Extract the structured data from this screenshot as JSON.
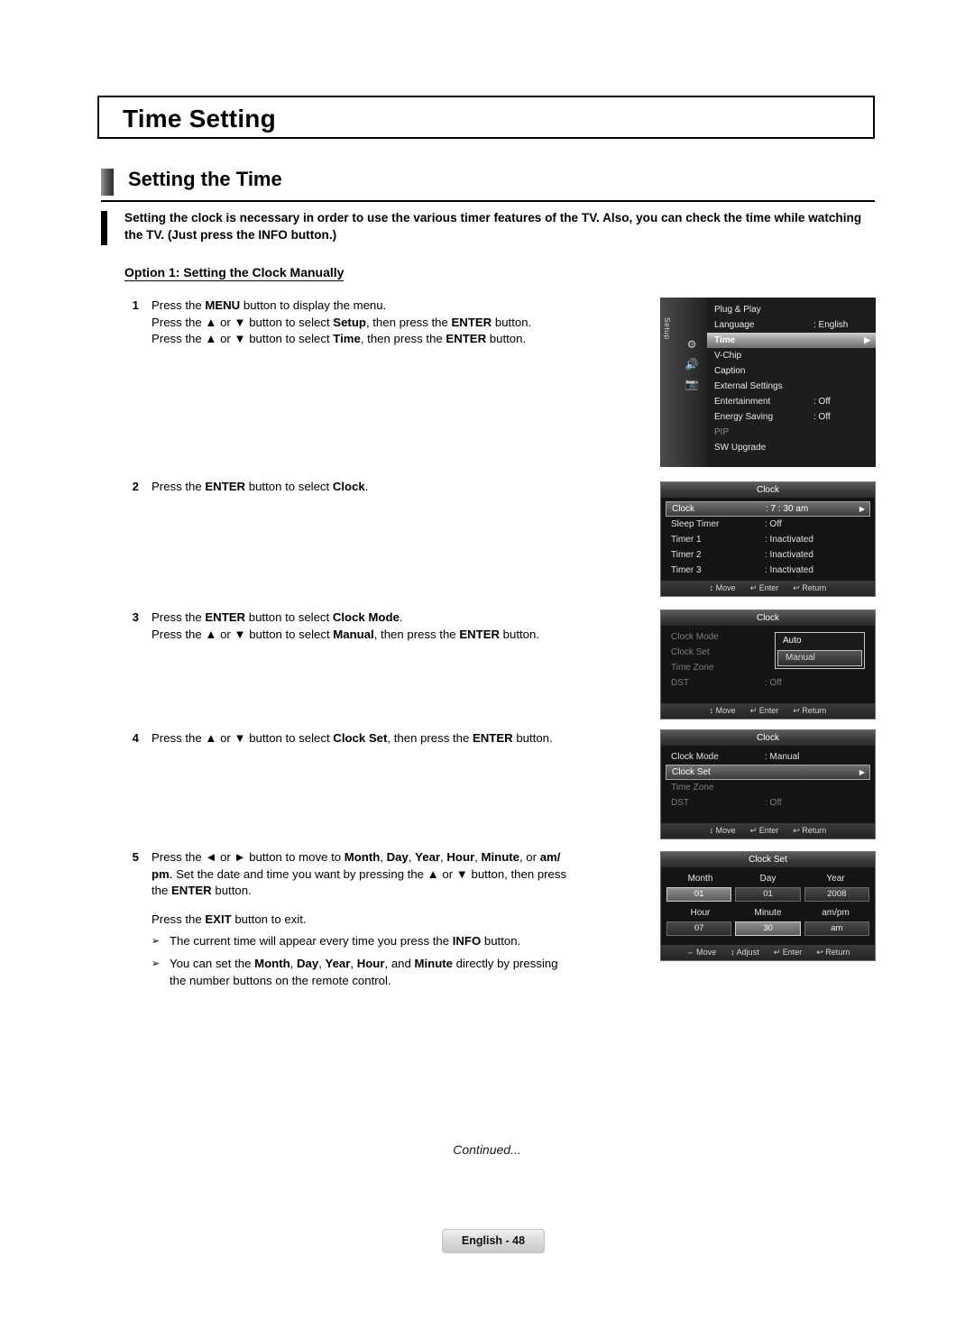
{
  "page": {
    "title": "Time Setting",
    "section_heading": "Setting the Time",
    "intro": "Setting the clock is necessary in order to use the various timer features of the TV. Also, you can check the time while watching the TV. (Just press the INFO button.)",
    "option_header": "Option 1: Setting the Clock Manually",
    "continued": "Continued...",
    "footer": "English - 48"
  },
  "steps": {
    "s1": {
      "num": "1",
      "l1_a": "Press the ",
      "l1_b": "MENU",
      "l1_c": " button to display the menu.",
      "l2_a": "Press the ▲ or ▼ button to select ",
      "l2_b": "Setup",
      "l2_c": ", then press the ",
      "l2_d": "ENTER",
      "l2_e": " button.",
      "l3_a": "Press the ▲ or ▼ button to select ",
      "l3_b": "Time",
      "l3_c": ", then press the ",
      "l3_d": "ENTER",
      "l3_e": " button."
    },
    "s2": {
      "num": "2",
      "a": "Press the ",
      "b": "ENTER",
      "c": " button to select ",
      "d": "Clock",
      "e": "."
    },
    "s3": {
      "num": "3",
      "l1_a": "Press the ",
      "l1_b": "ENTER",
      "l1_c": " button to select ",
      "l1_d": "Clock Mode",
      "l1_e": ".",
      "l2_a": "Press the ▲ or ▼ button to select ",
      "l2_b": "Manual",
      "l2_c": ", then press the ",
      "l2_d": "ENTER",
      "l2_e": " button."
    },
    "s4": {
      "num": "4",
      "a": "Press the ▲ or ▼ button to select ",
      "b": "Clock Set",
      "c": ", then press the ",
      "d": "ENTER",
      "e": " button."
    },
    "s5": {
      "num": "5",
      "l1_a": "Press the ◄ or ► button to move to ",
      "l1_b": "Month",
      "l1_c": ", ",
      "l1_d": "Day",
      "l1_e": ", ",
      "l1_f": "Year",
      "l1_g": ", ",
      "l1_h": "Hour",
      "l1_i": ", ",
      "l1_j": "Minute",
      "l1_k": ", or ",
      "l1_l": "am/",
      "l2_a": "pm",
      "l2_b": ". Set the date and time you want by pressing the ▲ or ▼ button, then press",
      "l3_a": "the ",
      "l3_b": "ENTER",
      "l3_c": " button.",
      "l4_a": "Press the ",
      "l4_b": "EXIT",
      "l4_c": " button to exit."
    },
    "bullets": [
      {
        "marker": "➢",
        "a": "The current time will appear every time you press the ",
        "b": "INFO",
        "c": " button."
      },
      {
        "marker": "➢",
        "a": "You can set the ",
        "b": "Month",
        "c": ", ",
        "d": "Day",
        "e": ", ",
        "f": "Year",
        "g": ", ",
        "h": "Hour",
        "i": ", and ",
        "j": "Minute",
        "k": " directly by pressing",
        "l": "the number buttons on the remote control."
      }
    ]
  },
  "osd": {
    "panel1": {
      "side_label": "Setup",
      "rows": [
        {
          "label": "Plug & Play",
          "value": ""
        },
        {
          "label": "Language",
          "value": ": English"
        },
        {
          "label": "Time",
          "value": "",
          "selected": true,
          "arrow": "▶"
        },
        {
          "label": "V-Chip",
          "value": ""
        },
        {
          "label": "Caption",
          "value": ""
        },
        {
          "label": "External Settings",
          "value": ""
        },
        {
          "label": "Entertainment",
          "value": ": Off"
        },
        {
          "label": "Energy Saving",
          "value": ": Off"
        },
        {
          "label": "PIP",
          "value": "",
          "dim": true
        },
        {
          "label": "SW Upgrade",
          "value": ""
        }
      ]
    },
    "panel2": {
      "title": "Clock",
      "rows": [
        {
          "label": "Clock",
          "value": ": 7 : 30 am",
          "hl": true,
          "arrow": "▶"
        },
        {
          "label": "Sleep Timer",
          "value": ": Off"
        },
        {
          "label": "Timer 1",
          "value": ": Inactivated"
        },
        {
          "label": "Timer 2",
          "value": ": Inactivated"
        },
        {
          "label": "Timer 3",
          "value": ": Inactivated"
        }
      ],
      "bottom": [
        "↕ Move",
        "↵ Enter",
        "↩ Return"
      ]
    },
    "panel3": {
      "title": "Clock",
      "rows": [
        {
          "label": "Clock Mode",
          "value": "",
          "dim": true
        },
        {
          "label": "Clock Set",
          "value": "",
          "dim": true
        },
        {
          "label": "Time Zone",
          "value": "",
          "dim": true
        },
        {
          "label": "DST",
          "value": ": Off",
          "dim": true
        }
      ],
      "popup": {
        "option1": "Auto",
        "option2": "Manual"
      },
      "bottom": [
        "↕ Move",
        "↵ Enter",
        "↩ Return"
      ]
    },
    "panel4": {
      "title": "Clock",
      "rows": [
        {
          "label": "Clock Mode",
          "value": ": Manual"
        },
        {
          "label": "Clock Set",
          "value": "",
          "hl": true,
          "arrow": "▶"
        },
        {
          "label": "Time Zone",
          "value": "",
          "dim": true
        },
        {
          "label": "DST",
          "value": ": Off",
          "dim": true
        }
      ],
      "bottom": [
        "↕ Move",
        "↵ Enter",
        "↩ Return"
      ]
    },
    "panel5": {
      "title": "Clock Set",
      "headers1": [
        "Month",
        "Day",
        "Year"
      ],
      "values1": [
        "01",
        "01",
        "2008"
      ],
      "headers2": [
        "Hour",
        "Minute",
        "am/pm"
      ],
      "values2": [
        "07",
        "30",
        "am"
      ],
      "bottom": [
        "⇔ Move",
        "↕ Adjust",
        "↵ Enter",
        "↩ Return"
      ]
    }
  }
}
